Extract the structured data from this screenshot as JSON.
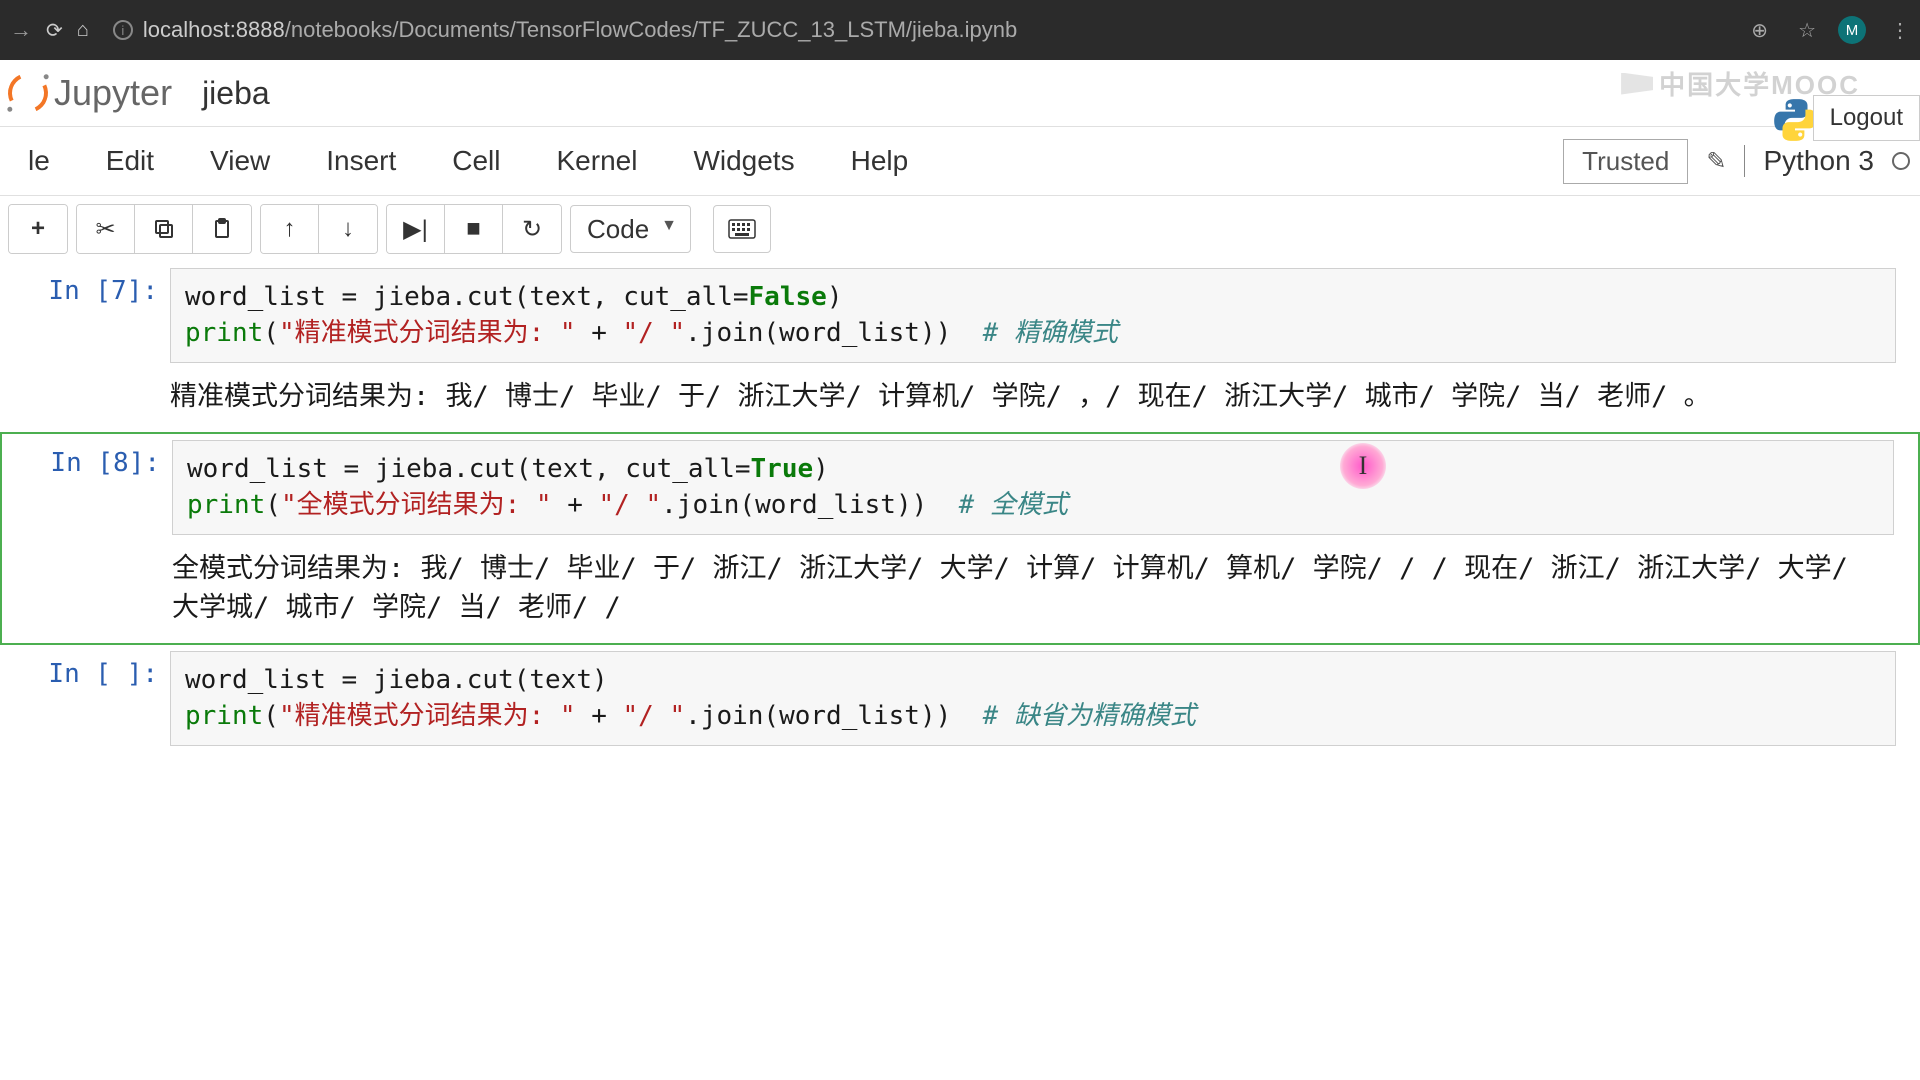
{
  "browser": {
    "url_host": "localhost:8888",
    "url_path": "/notebooks/Documents/TensorFlowCodes/TF_ZUCC_13_LSTM/jieba.ipynb",
    "avatar_letter": "M"
  },
  "header": {
    "logo_text": "Jupyter",
    "notebook_name": "jieba",
    "watermark": "中国大学MOOC",
    "logout": "Logout"
  },
  "menus": {
    "file": "le",
    "edit": "Edit",
    "view": "View",
    "insert": "Insert",
    "cell": "Cell",
    "kernel": "Kernel",
    "widgets": "Widgets",
    "help": "Help",
    "trusted": "Trusted",
    "kernel_name": "Python 3"
  },
  "toolbar": {
    "cell_type": "Code"
  },
  "cells": [
    {
      "prompt": "In [7]:",
      "code_html": "word_list = jieba.cut(text, cut_all=<span class='kw-false'>False</span>)\n<span class='builtin'>print</span>(<span class='str'>\"精准模式分词结果为: \"</span> + <span class='str'>\"/ \"</span>.join(word_list))  <span class='comment'># 精确模式</span>",
      "output": "精准模式分词结果为: 我/ 博士/ 毕业/ 于/ 浙江大学/ 计算机/ 学院/ ，/ 现在/ 浙江大学/ 城市/ 学院/ 当/ 老师/ 。"
    },
    {
      "prompt": "In [8]:",
      "code_html": "word_list = jieba.cut(text, cut_all=<span class='kw-true'>True</span>)\n<span class='builtin'>print</span>(<span class='str'>\"全模式分词结果为: \"</span> + <span class='str'>\"/ \"</span>.join(word_list))  <span class='comment'># 全模式</span>",
      "output": "全模式分词结果为: 我/ 博士/ 毕业/ 于/ 浙江/ 浙江大学/ 大学/ 计算/ 计算机/ 算机/ 学院/ / / 现在/ 浙江/ 浙江大学/ 大学/ 大学城/ 城市/ 学院/ 当/ 老师/ / "
    },
    {
      "prompt": "In [ ]:",
      "code_html": "word_list = jieba.cut(text)\n<span class='builtin'>print</span>(<span class='str'>\"精准模式分词结果为: \"</span> + <span class='str'>\"/ \"</span>.join(word_list))  <span class='comment'># 缺省为精确模式</span>",
      "output": ""
    }
  ],
  "cursor": {
    "glyph": "I"
  }
}
